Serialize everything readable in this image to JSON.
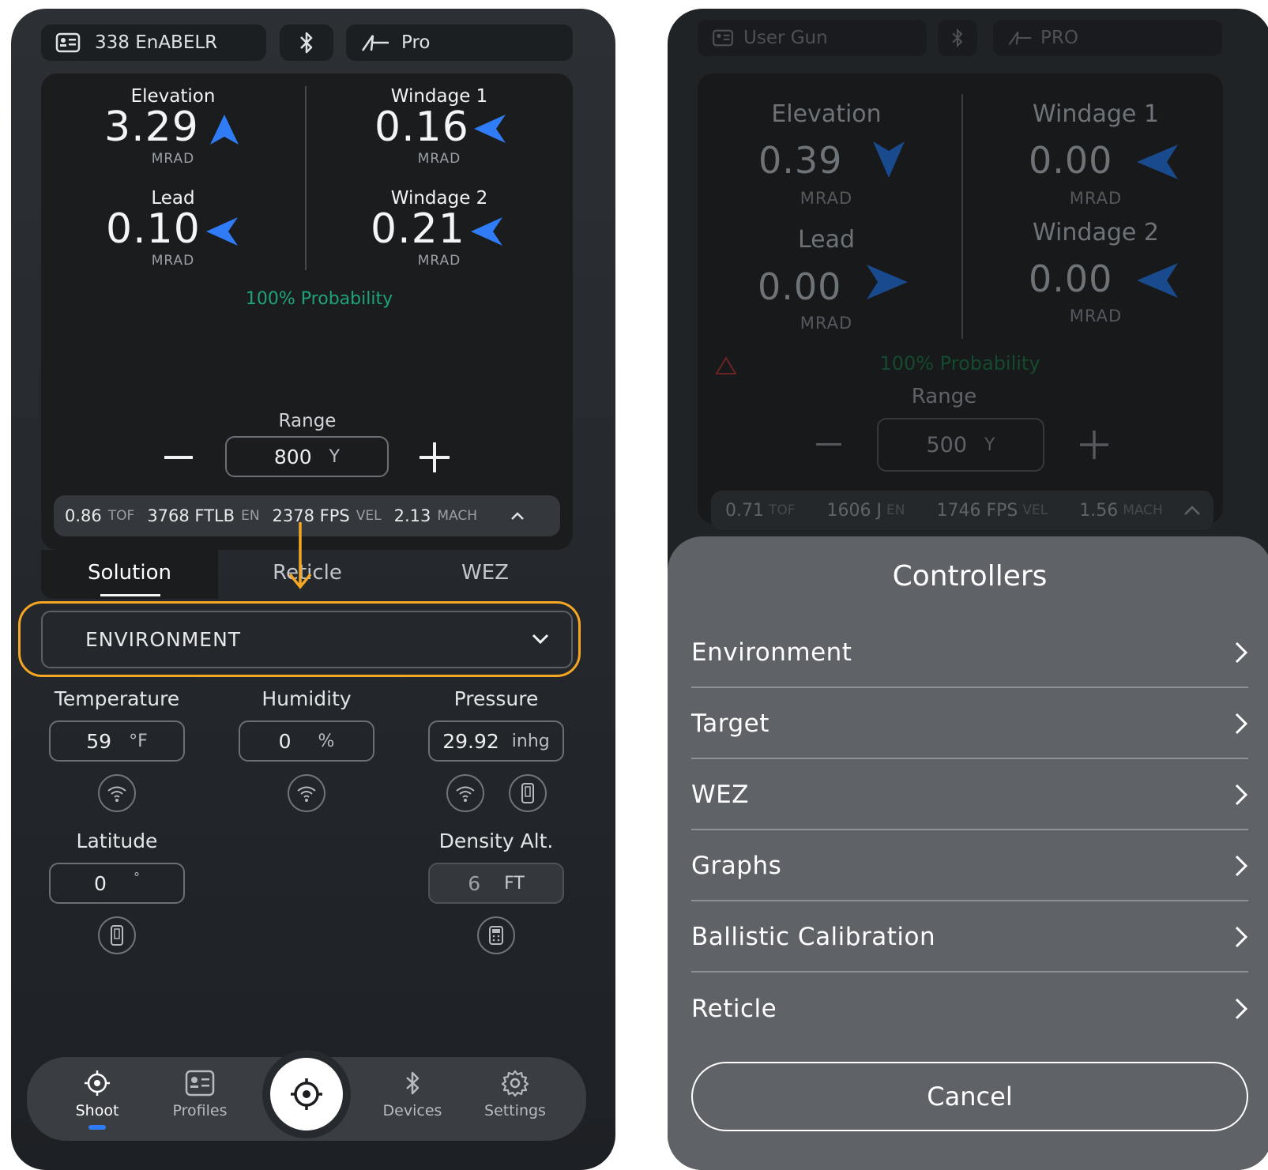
{
  "left": {
    "header": {
      "gun_name": "338 EnABELR",
      "bluetooth_icon": "bluetooth-icon",
      "brand_label": "Pro"
    },
    "solution": {
      "elevation": {
        "label": "Elevation",
        "value": "3.29",
        "unit": "MRAD",
        "direction": "up"
      },
      "windage1": {
        "label": "Windage 1",
        "value": "0.16",
        "unit": "MRAD",
        "direction": "left"
      },
      "lead": {
        "label": "Lead",
        "value": "0.10",
        "unit": "MRAD",
        "direction": "left"
      },
      "windage2": {
        "label": "Windage 2",
        "value": "0.21",
        "unit": "MRAD",
        "direction": "left"
      },
      "probability": "100% Probability"
    },
    "range": {
      "label": "Range",
      "value": "800",
      "unit": "Y",
      "minus": "−",
      "plus": "+"
    },
    "stats": [
      {
        "value": "0.86",
        "label": "TOF"
      },
      {
        "value": "3768 FTLB",
        "label": "EN"
      },
      {
        "value": "2378 FPS",
        "label": "VEL"
      },
      {
        "value": "2.13",
        "label": "MACH"
      }
    ],
    "tabs": [
      "Solution",
      "Reticle",
      "WEZ"
    ],
    "active_tab": "Solution",
    "section_dropdown": "ENVIRONMENT",
    "env": {
      "temperature": {
        "label": "Temperature",
        "value": "59",
        "unit": "°F"
      },
      "humidity": {
        "label": "Humidity",
        "value": "0",
        "unit": "%"
      },
      "pressure": {
        "label": "Pressure",
        "value": "29.92",
        "unit": "inhg"
      },
      "latitude": {
        "label": "Latitude",
        "value": "0",
        "unit": "°"
      },
      "density_alt": {
        "label": "Density Alt.",
        "value": "6",
        "unit": "FT"
      }
    },
    "nav": [
      {
        "label": "Shoot",
        "icon": "crosshair-icon"
      },
      {
        "label": "Profiles",
        "icon": "profile-card-icon"
      },
      {
        "label": "Devices",
        "icon": "bluetooth-icon"
      },
      {
        "label": "Settings",
        "icon": "gear-icon"
      }
    ],
    "accent": "#2f7cf6",
    "highlight": "#f5a623",
    "probability_color": "#1fa37a"
  },
  "right": {
    "header": {
      "gun_name": "User Gun",
      "brand_label": "PRO"
    },
    "solution": {
      "elevation": {
        "label": "Elevation",
        "value": "0.39",
        "unit": "MRAD",
        "direction": "down"
      },
      "windage1": {
        "label": "Windage 1",
        "value": "0.00",
        "unit": "MRAD",
        "direction": "left"
      },
      "lead": {
        "label": "Lead",
        "value": "0.00",
        "unit": "MRAD",
        "direction": "right"
      },
      "windage2": {
        "label": "Windage 2",
        "value": "0.00",
        "unit": "MRAD",
        "direction": "left"
      },
      "probability": "100% Probability"
    },
    "range": {
      "label": "Range",
      "value": "500",
      "unit": "Y",
      "minus": "−",
      "plus": "+"
    },
    "stats": [
      {
        "value": "0.71",
        "label": "TOF"
      },
      {
        "value": "1606 J",
        "label": "EN"
      },
      {
        "value": "1746 FPS",
        "label": "VEL"
      },
      {
        "value": "1.56",
        "label": "MACH"
      }
    ],
    "sheet": {
      "title": "Controllers",
      "items": [
        "Environment",
        "Target",
        "WEZ",
        "Graphs",
        "Ballistic Calibration",
        "Reticle"
      ],
      "cancel": "Cancel"
    }
  }
}
